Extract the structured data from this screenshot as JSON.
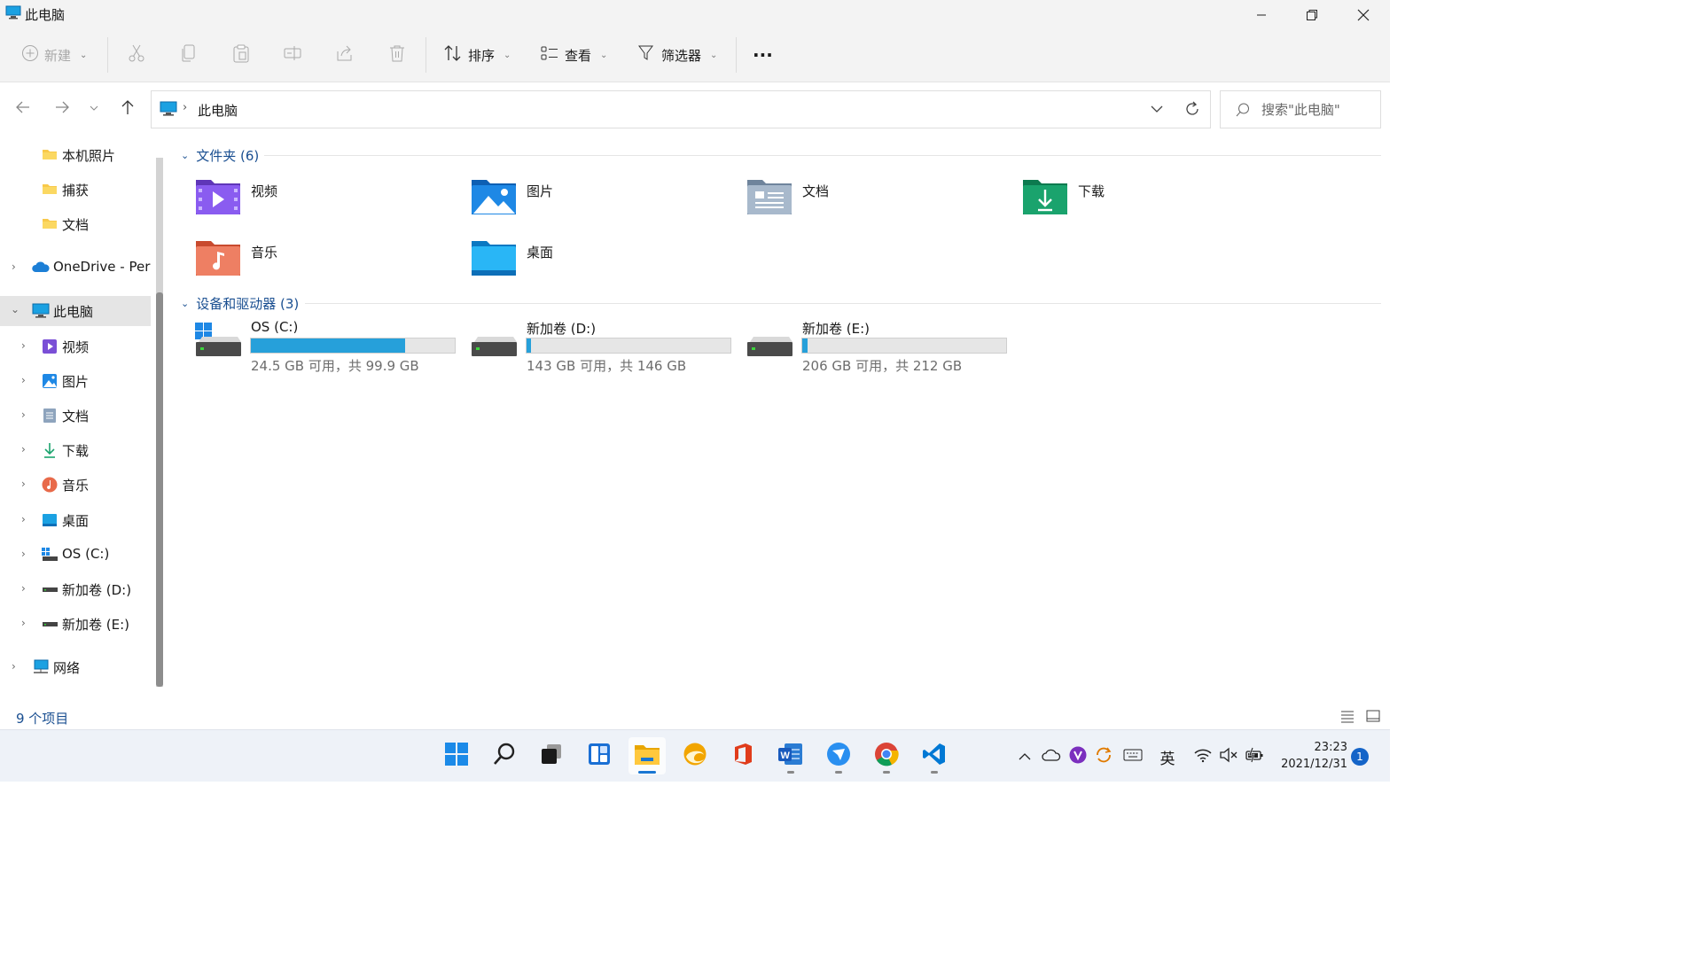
{
  "window": {
    "title": "此电脑"
  },
  "toolbar": {
    "new_label": "新建",
    "sort_label": "排序",
    "view_label": "查看",
    "filter_label": "筛选器",
    "more_label": "···"
  },
  "address": {
    "crumb": "此电脑",
    "search_placeholder": "搜索\"此电脑\""
  },
  "sidebar": {
    "items": [
      {
        "label": "本机照片",
        "icon": "folder-icon"
      },
      {
        "label": "捕获",
        "icon": "folder-icon"
      },
      {
        "label": "文档",
        "icon": "folder-icon"
      },
      {
        "label": "OneDrive - Personal",
        "icon": "onedrive-icon"
      },
      {
        "label": "此电脑",
        "icon": "computer-icon"
      },
      {
        "label": "视频",
        "icon": "videos-icon"
      },
      {
        "label": "图片",
        "icon": "pictures-icon"
      },
      {
        "label": "文档",
        "icon": "documents-icon"
      },
      {
        "label": "下载",
        "icon": "download-icon"
      },
      {
        "label": "音乐",
        "icon": "music-icon"
      },
      {
        "label": "桌面",
        "icon": "desktop-icon"
      },
      {
        "label": "OS (C:)",
        "icon": "drive-icon"
      },
      {
        "label": "新加卷 (D:)",
        "icon": "drive-icon"
      },
      {
        "label": "新加卷 (E:)",
        "icon": "drive-icon"
      },
      {
        "label": "网络",
        "icon": "network-icon"
      }
    ]
  },
  "folders": {
    "header": "文件夹 (6)",
    "items": [
      {
        "label": "视频",
        "color": "#7a4fd6"
      },
      {
        "label": "图片",
        "color": "#1e88e5"
      },
      {
        "label": "文档",
        "color": "#8ea4bd"
      },
      {
        "label": "下载",
        "color": "#1aa36d"
      },
      {
        "label": "音乐",
        "color": "#e86a4a"
      },
      {
        "label": "桌面",
        "color": "#1ba1e2"
      }
    ]
  },
  "drives": {
    "header": "设备和驱动器 (3)",
    "items": [
      {
        "label": "OS (C:)",
        "free": "24.5 GB 可用，共 99.9 GB",
        "used_fraction": 0.755
      },
      {
        "label": "新加卷 (D:)",
        "free": "143 GB 可用，共 146 GB",
        "used_fraction": 0.02
      },
      {
        "label": "新加卷 (E:)",
        "free": "206 GB 可用，共 212 GB",
        "used_fraction": 0.028
      }
    ]
  },
  "status": {
    "item_count": "9 个项目"
  },
  "taskbar": {
    "ime_label": "英",
    "time": "23:23",
    "date": "2021/12/31",
    "notification_count": "1"
  },
  "colors": {
    "accent": "#1976d2",
    "drive_bar": "#26a0da",
    "link_blue": "#1a4f91"
  }
}
